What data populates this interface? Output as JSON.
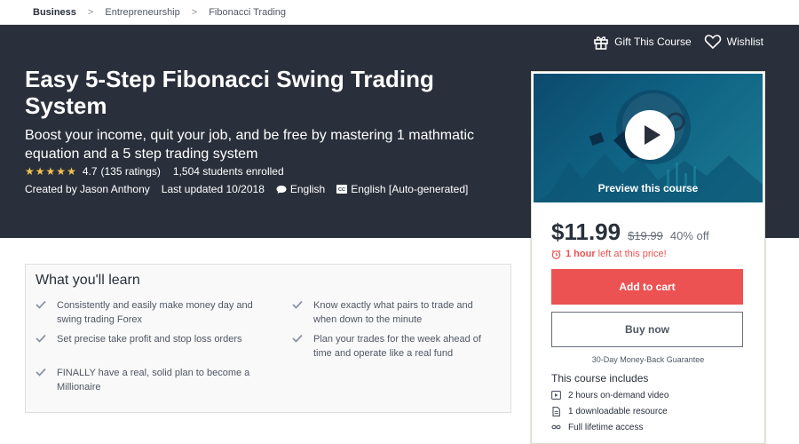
{
  "breadcrumb": [
    "Business",
    "Entrepreneurship",
    "Fibonacci Trading"
  ],
  "breadcrumb_separator": ">",
  "header_actions": {
    "gift": "Gift This Course",
    "wishlist": "Wishlist"
  },
  "course": {
    "title": "Easy 5-Step Fibonacci Swing Trading System",
    "subtitle": "Boost your income, quit your job, and be free by mastering 1 mathmatic equation and a 5 step trading system",
    "rating_value": "4.7",
    "rating_count": "(135 ratings)",
    "stars_filled": 5,
    "students": "1,504 students enrolled",
    "created_by": "Created by Jason Anthony",
    "last_updated": "Last updated 10/2018",
    "language": "English",
    "captions": "English [Auto-generated]"
  },
  "sidebar": {
    "preview_label": "Preview this course",
    "price": "$11.99",
    "original_price": "$19.99",
    "discount": "40% off",
    "timer_strong": "1 hour",
    "timer_text": "left at this price!",
    "add_to_cart": "Add to cart",
    "buy_now": "Buy now",
    "guarantee": "30-Day Money-Back Guarantee",
    "includes_title": "This course includes",
    "includes": [
      {
        "icon": "video-icon",
        "text": "2 hours on-demand video"
      },
      {
        "icon": "file-icon",
        "text": "1 downloadable resource"
      },
      {
        "icon": "infinity-icon",
        "text": "Full lifetime access"
      }
    ]
  },
  "learn": {
    "title": "What you'll learn",
    "items": [
      "Consistently and easily make money day and swing trading Forex",
      "Know exactly what pairs to trade and when down to the minute",
      "Set precise take profit and stop loss orders",
      "Plan your trades for the week ahead of time and operate like a real fund",
      "FINALLY have a real, solid plan to become a Millionaire"
    ]
  },
  "colors": {
    "hero_bg": "#29303b",
    "accent_red": "#ec5252",
    "star": "#f4c150"
  }
}
